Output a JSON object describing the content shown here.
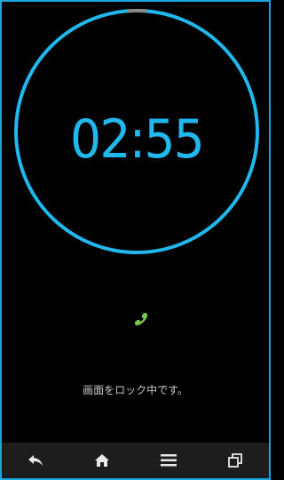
{
  "timer": {
    "time_display": "02:55",
    "ring_color": "#21b8ee"
  },
  "status": {
    "lock_message": "画面をロック中です。"
  },
  "icons": {
    "phone": "phone-icon",
    "back": "back-icon",
    "home": "home-icon",
    "menu": "menu-icon",
    "recent": "recent-apps-icon"
  },
  "colors": {
    "accent": "#21b8ee",
    "phone_green": "#7ac943",
    "navbar_bg": "#1d1d1d"
  }
}
